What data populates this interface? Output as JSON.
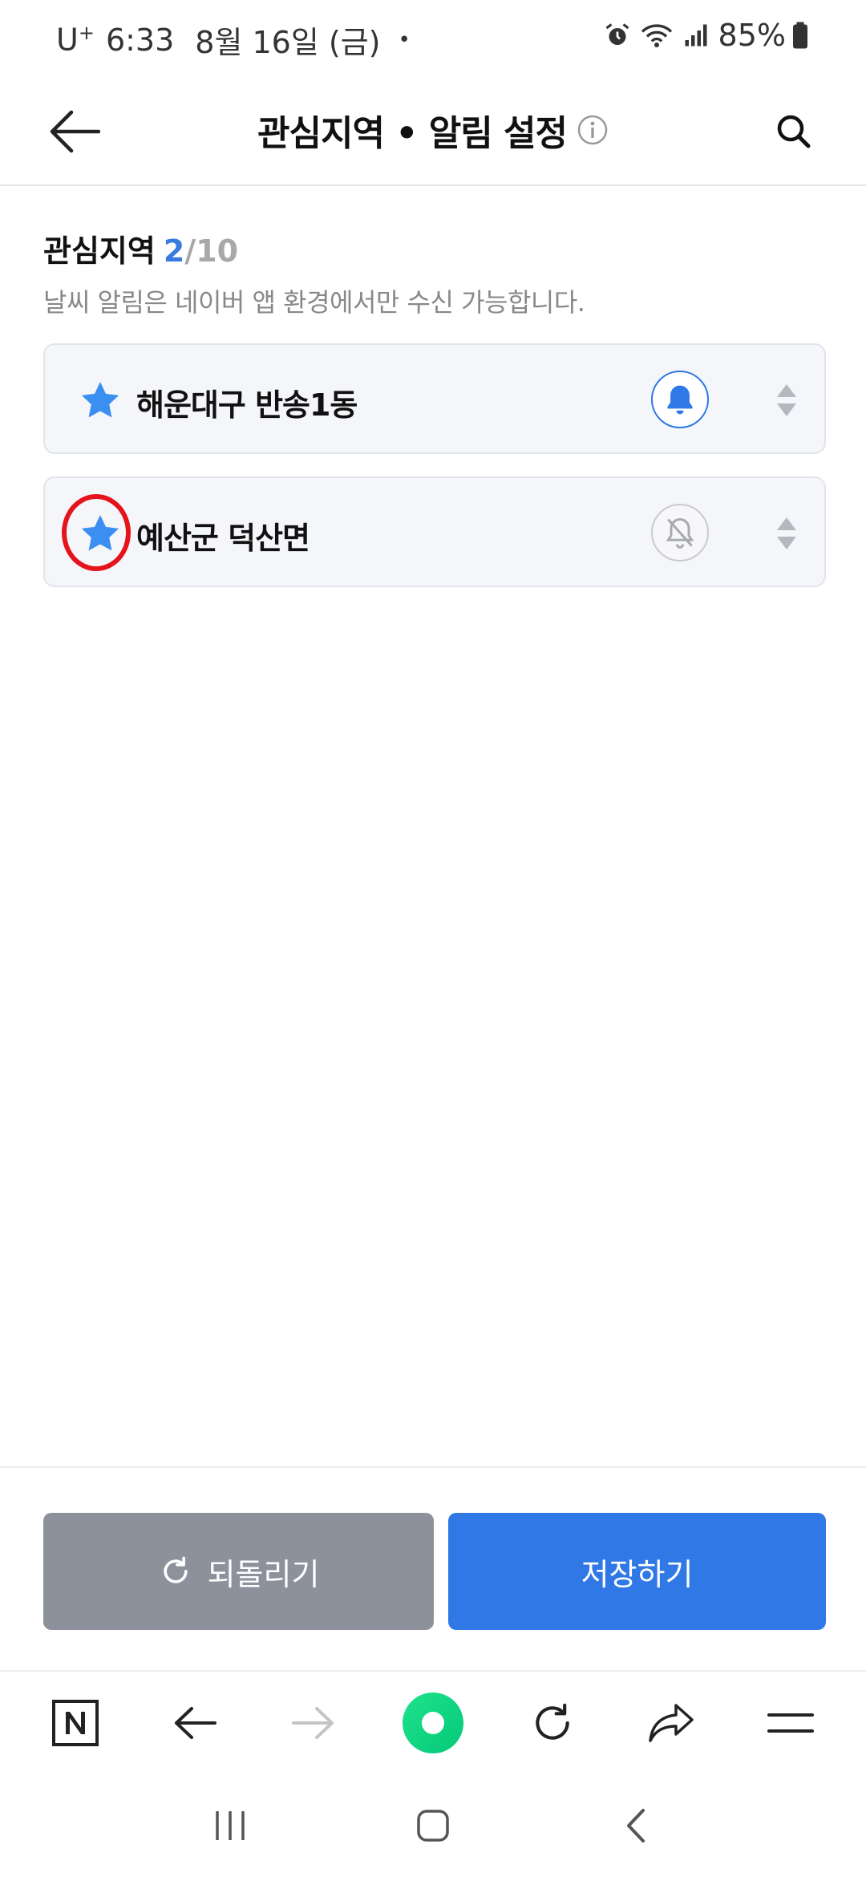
{
  "status_bar": {
    "carrier": "U",
    "carrier_sup": "+",
    "time": "6:33",
    "date": "8월 16일 (금)",
    "dot": "•",
    "battery": "85%"
  },
  "header": {
    "title": "관심지역 • 알림 설정"
  },
  "section": {
    "title": "관심지역",
    "count_current": "2",
    "count_sep": "/",
    "count_max": "10",
    "description": "날씨 알림은 네이버 앱 환경에서만 수신 가능합니다."
  },
  "regions": [
    {
      "name": "해운대구 반송1동",
      "notification": "on"
    },
    {
      "name": "예산군 덕산면",
      "notification": "off"
    }
  ],
  "actions": {
    "reset_label": "되돌리기",
    "save_label": "저장하기"
  },
  "colors": {
    "accent": "#2f78e6",
    "star": "#3a8ff0",
    "reset_button": "#8c919c",
    "highlight": "#e5141c",
    "home_button": "#06c97a"
  },
  "icons": {
    "header": [
      "back-arrow-icon",
      "info-icon",
      "search-icon"
    ],
    "region": [
      "star-icon",
      "bell-icon",
      "bell-off-icon",
      "sort-handle-icon"
    ],
    "toolbar": [
      "naver-n-icon",
      "back-icon",
      "forward-icon",
      "home-icon",
      "refresh-icon",
      "share-icon",
      "menu-icon"
    ],
    "system_nav": [
      "recents-icon",
      "home-icon",
      "back-icon"
    ]
  }
}
